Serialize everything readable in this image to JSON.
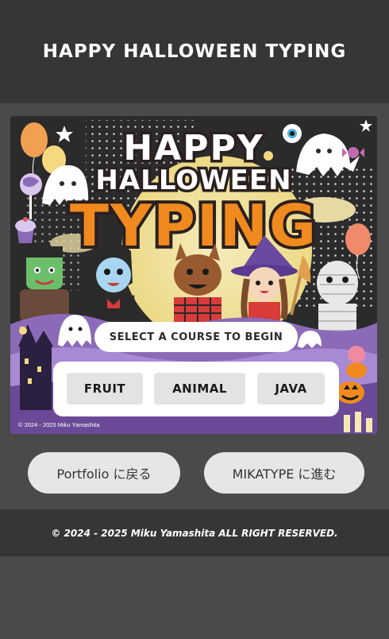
{
  "header": {
    "title": "HAPPY HALLOWEEN TYPING"
  },
  "game": {
    "logo_line1": "HAPPY",
    "logo_line2": "HALLOWEEN",
    "logo_line3": "TYPING",
    "prompt": "SELECT A COURSE TO BEGIN",
    "courses": [
      {
        "label": "FRUIT"
      },
      {
        "label": "ANIMAL"
      },
      {
        "label": "JAVA"
      }
    ],
    "credit": "© 2024 - 2025 Miku Yamashita"
  },
  "nav": {
    "portfolio_label": "Portfolio に戻る",
    "mikatype_label": "MIKATYPE に進む"
  },
  "footer": {
    "copyright": "© 2024 - 2025 Miku Yamashita ALL RIGHT RESERVED."
  },
  "colors": {
    "header_bg": "#363636",
    "page_bg": "#4a4a4a",
    "logo_orange": "#f08a1e",
    "logo_dark": "#2a2020",
    "purple_hills": "#8b6bb8",
    "button_bg": "#e3e3e3"
  }
}
